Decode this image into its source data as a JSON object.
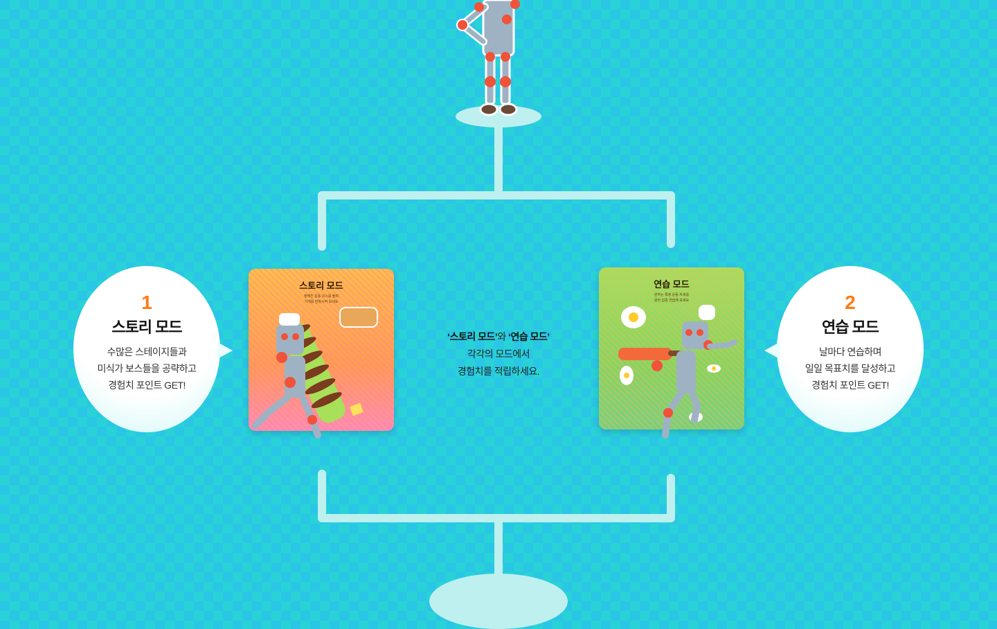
{
  "modes": [
    {
      "number": "1",
      "title": "스토리 모드",
      "description": "수많은 스테이지들과\n미식가 보스들을 공략하고\n경험치 포인트 GET!",
      "card_title": "스토리 모드",
      "card_subtitle": "정해진 운동 코스를 돌며\n가게를 번창시켜 보세요"
    },
    {
      "number": "2",
      "title": "연습 모드",
      "description": "날마다 연습하며\n일일 목표치를 달성하고\n경험치 포인트 GET!",
      "card_title": "연습 모드",
      "card_subtitle": "원하는 특정 운동 자세를\n골라 집중 연습해 보세요"
    }
  ],
  "center": {
    "quote_story": "‘스토리 모드’",
    "conj": "와 ",
    "quote_practice": "‘연습 모드’",
    "line2": "각각의 모드에서",
    "line3": "경험치를 적립하세요."
  },
  "colors": {
    "accent_number": "#ff7a12",
    "line": "#bdf0ee",
    "story_card": "#ffb13d",
    "practice_card": "#8fe05a",
    "robot_body": "#9fb2c4",
    "robot_joint": "#f0523a"
  }
}
